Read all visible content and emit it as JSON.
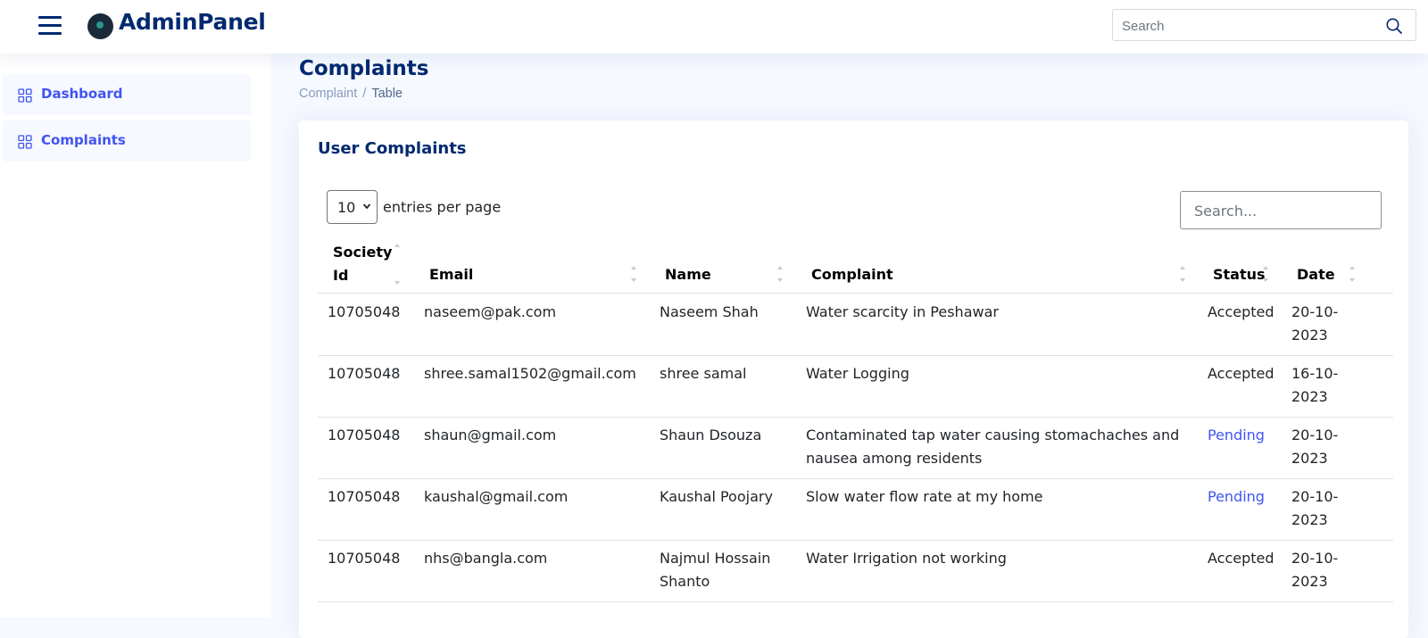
{
  "header": {
    "brand": "AdminPanel",
    "search_placeholder": "Search"
  },
  "sidebar": {
    "items": [
      {
        "label": "Dashboard"
      },
      {
        "label": "Complaints"
      }
    ]
  },
  "page": {
    "title": "Complaints",
    "breadcrumb": [
      "Complaint",
      "Table"
    ]
  },
  "card": {
    "title": "User Complaints",
    "entries_value": "10",
    "entries_label": "entries per page",
    "search_placeholder": "Search..."
  },
  "table": {
    "columns": [
      {
        "line1": "Society",
        "line2": "Id"
      },
      {
        "line1": "Email"
      },
      {
        "line1": "Name"
      },
      {
        "line1": "Complaint"
      },
      {
        "line1": "Status"
      },
      {
        "line1": "Date"
      }
    ],
    "rows": [
      {
        "id": "10705048",
        "email": "naseem@pak.com",
        "name": [
          "Naseem Shah"
        ],
        "complaint": [
          "Water scarcity in Peshawar"
        ],
        "status": "Accepted",
        "date": [
          "20-10-",
          "2023"
        ]
      },
      {
        "id": "10705048",
        "email": "shree.samal1502@gmail.com",
        "name": [
          "shree samal"
        ],
        "complaint": [
          "Water Logging"
        ],
        "status": "Accepted",
        "date": [
          "16-10-",
          "2023"
        ]
      },
      {
        "id": "10705048",
        "email": "shaun@gmail.com",
        "name": [
          "Shaun Dsouza"
        ],
        "complaint": [
          "Contaminated tap water causing stomachaches and",
          "nausea among residents"
        ],
        "status": "Pending",
        "date": [
          "20-10-",
          "2023"
        ]
      },
      {
        "id": "10705048",
        "email": "kaushal@gmail.com",
        "name": [
          "Kaushal Poojary"
        ],
        "complaint": [
          "Slow water flow rate at my home"
        ],
        "status": "Pending",
        "date": [
          "20-10-",
          "2023"
        ]
      },
      {
        "id": "10705048",
        "email": "nhs@bangla.com",
        "name": [
          "Najmul Hossain",
          "Shanto"
        ],
        "complaint": [
          "Water Irrigation not working"
        ],
        "status": "Accepted",
        "date": [
          "20-10-",
          "2023"
        ]
      }
    ]
  },
  "colors": {
    "accent": "#4154f1",
    "navy": "#012970",
    "page_bg": "#f6f9ff"
  }
}
